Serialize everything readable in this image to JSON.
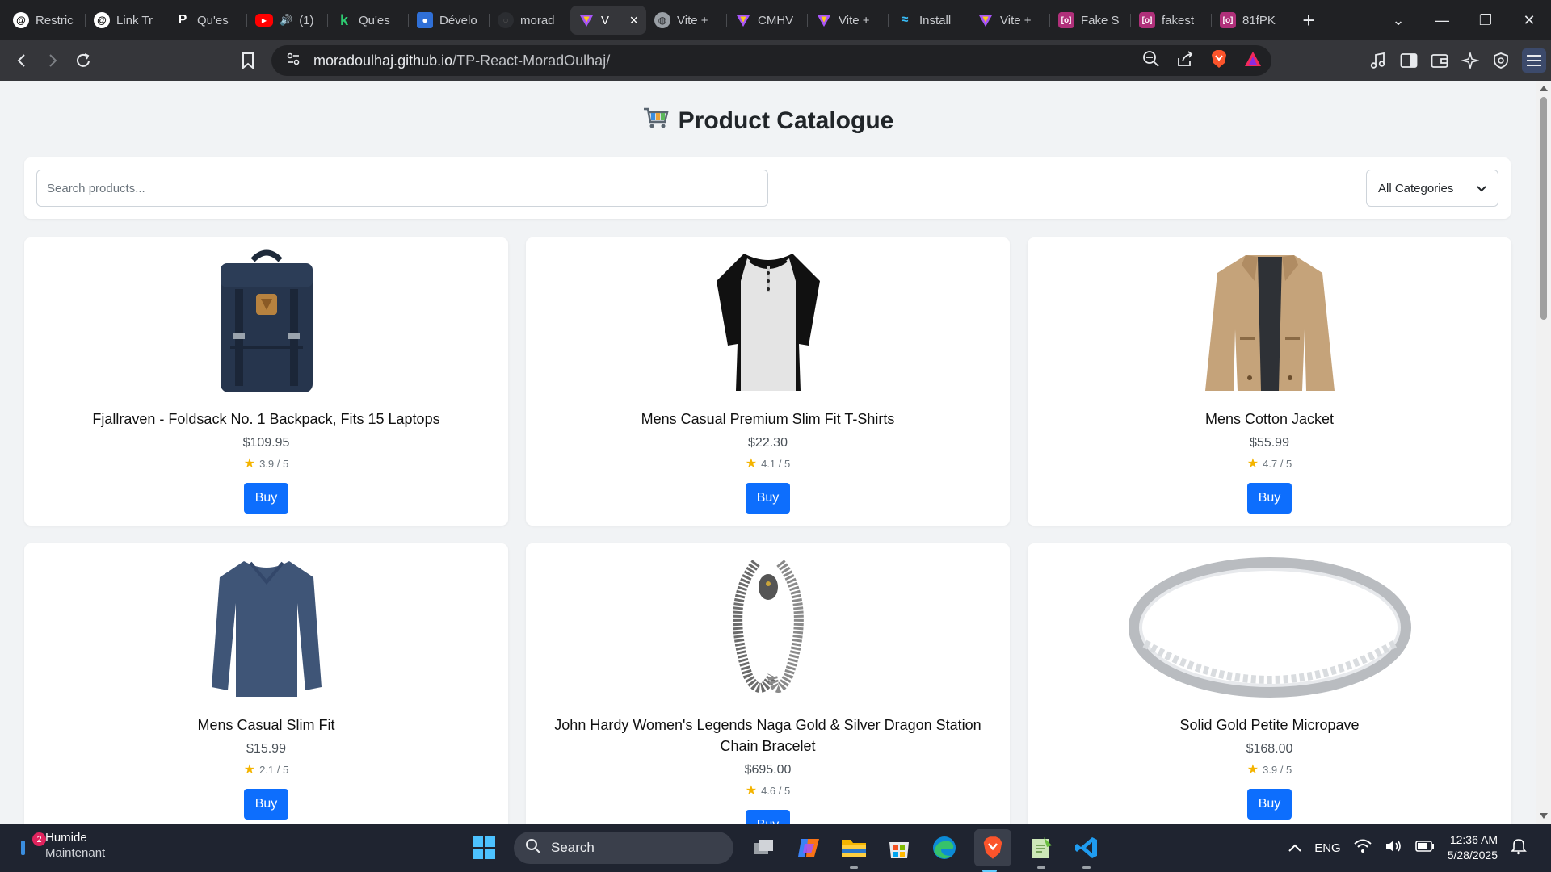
{
  "browser": {
    "tabs": [
      {
        "label": "Restric",
        "icon": "threads-icon",
        "active": false
      },
      {
        "label": "Link Tr",
        "icon": "threads-icon",
        "active": false
      },
      {
        "label": "Qu'es",
        "icon": "p-icon",
        "active": false
      },
      {
        "label": "(1)",
        "icon": "youtube-icon",
        "active": false
      },
      {
        "label": "Qu'es",
        "icon": "k-icon",
        "active": false
      },
      {
        "label": "Dévelo",
        "icon": "profile-icon",
        "active": false
      },
      {
        "label": "morad",
        "icon": "github-icon",
        "active": false
      },
      {
        "label": "V",
        "icon": "vite-icon",
        "active": true
      },
      {
        "label": "Vite +",
        "icon": "globe-icon",
        "active": false
      },
      {
        "label": "CMHV",
        "icon": "vite-icon",
        "active": false
      },
      {
        "label": "Vite +",
        "icon": "vite-icon",
        "active": false
      },
      {
        "label": "Install",
        "icon": "tailwind-icon",
        "active": false
      },
      {
        "label": "Vite +",
        "icon": "vite-icon",
        "active": false
      },
      {
        "label": "Fake S",
        "icon": "bracket-icon",
        "active": false
      },
      {
        "label": "fakest",
        "icon": "bracket-icon",
        "active": false
      },
      {
        "label": "81fPK",
        "icon": "bracket-icon",
        "active": false
      }
    ],
    "address": {
      "domain": "moradoulhaj.github.io",
      "path": "/TP-React-MoradOulhaj/"
    }
  },
  "page": {
    "title": "Product Catalogue",
    "title_icon": "shopping-cart-icon",
    "search_placeholder": "Search products...",
    "category_selected": "All Categories",
    "buy_label": "Buy",
    "rating_icon": "star-icon"
  },
  "products": [
    {
      "title": "Fjallraven - Foldsack No. 1 Backpack, Fits 15 Laptops",
      "price": "$109.95",
      "rating": "3.9 / 5",
      "image": "backpack"
    },
    {
      "title": "Mens Casual Premium Slim Fit T-Shirts",
      "price": "$22.30",
      "rating": "4.1 / 5",
      "image": "tshirt"
    },
    {
      "title": "Mens Cotton Jacket",
      "price": "$55.99",
      "rating": "4.7 / 5",
      "image": "jacket"
    },
    {
      "title": "Mens Casual Slim Fit",
      "price": "$15.99",
      "rating": "2.1 / 5",
      "image": "longsleeve"
    },
    {
      "title": "John Hardy Women's Legends Naga Gold & Silver Dragon Station Chain Bracelet",
      "price": "$695.00",
      "rating": "4.6 / 5",
      "image": "bracelet"
    },
    {
      "title": "Solid Gold Petite Micropave",
      "price": "$168.00",
      "rating": "3.9 / 5",
      "image": "ring"
    }
  ],
  "taskbar": {
    "weather_title": "Humide",
    "weather_sub": "Maintenant",
    "notification_count": "2",
    "search_label": "Search",
    "language": "ENG",
    "time": "12:36 AM",
    "date": "5/28/2025"
  },
  "colors": {
    "accent": "#0d6efd",
    "page_bg": "#f1f3f5",
    "browser_bg": "#202124",
    "taskbar_bg": "#1f2430"
  }
}
